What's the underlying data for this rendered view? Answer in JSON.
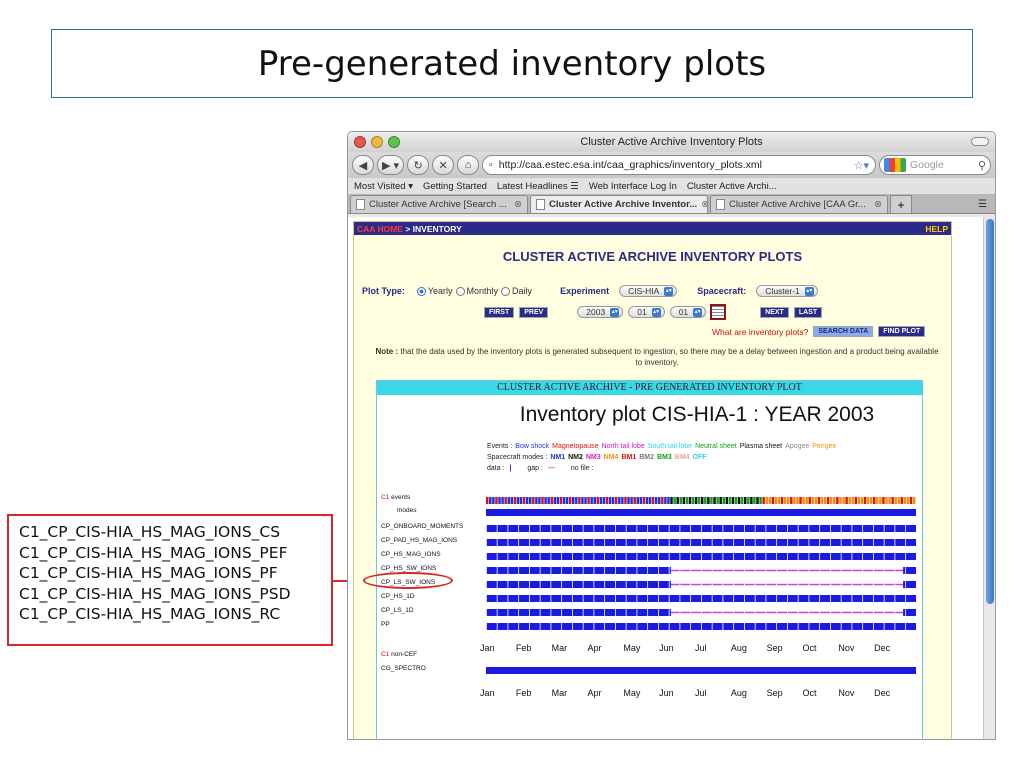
{
  "slide": {
    "title": "Pre-generated inventory plots",
    "callout_lines": [
      "C1_CP_CIS-HIA_HS_MAG_IONS_CS",
      "C1_CP_CIS-HIA_HS_MAG_IONS_PEF",
      "C1_CP_CIS-HIA_HS_MAG_IONS_PF",
      "C1_CP_CIS-HIA_HS_MAG_IONS_PSD",
      "C1_CP_CIS-HIA_HS_MAG_IONS_RC"
    ],
    "accent_color": "#d62a2a"
  },
  "browser": {
    "window_title": "Cluster Active Archive Inventory Plots",
    "url": "http://caa.estec.esa.int/caa_graphics/inventory_plots.xml",
    "search_placeholder": "Google",
    "bookmarks": [
      "Most Visited ▾",
      "Getting Started",
      "Latest Headlines ☰",
      "Web Interface Log In",
      "Cluster Active Archi..."
    ],
    "tabs": [
      {
        "label": "Cluster Active Archive [Search ..."
      },
      {
        "label": "Cluster Active Archive Inventor..."
      },
      {
        "label": "Cluster Active Archive [CAA Gr..."
      }
    ]
  },
  "page": {
    "home_link": "CAA HOME",
    "breadcrumb": "> INVENTORY",
    "help": "HELP",
    "heading": "CLUSTER ACTIVE ARCHIVE INVENTORY PLOTS",
    "plot_type_label": "Plot Type:",
    "plot_types": [
      "Yearly",
      "Monthly",
      "Daily"
    ],
    "experiment_label": "Experiment",
    "experiment_value": "CIS-HIA",
    "spacecraft_label": "Spacecraft:",
    "spacecraft_value": "Cluster-1",
    "first": "FIRST",
    "prev": "PREV",
    "year": "2003",
    "month": "01",
    "day": "01",
    "next": "NEXT",
    "last": "LAST",
    "what_link": "What are inventory plots?",
    "search_data": "SEARCH DATA",
    "find_plot": "FIND PLOT",
    "note_bold": "Note :",
    "note_text": "that the data used by the inventory plots is generated subsequent to ingestion, so there may be a delay between ingestion and a product being available to inventory."
  },
  "plot": {
    "header": "CLUSTER ACTIVE ARCHIVE - PRE GENERATED INVENTORY PLOT",
    "title": "Inventory plot CIS-HIA-1 : YEAR 2003",
    "events_label": "Events :",
    "events": [
      {
        "name": "Bow shock",
        "color": "#2030e0"
      },
      {
        "name": "Magnetopause",
        "color": "#e01010"
      },
      {
        "name": "North tail lobe",
        "color": "#d020d0"
      },
      {
        "name": "South tail lobe",
        "color": "#30d0f0"
      },
      {
        "name": "Neutral sheet",
        "color": "#10a010"
      },
      {
        "name": "Plasma sheet",
        "color": "#111111"
      },
      {
        "name": "Apogee",
        "color": "#888888"
      },
      {
        "name": "Perigee",
        "color": "#f09010"
      }
    ],
    "modes_label": "Spacecraft modes :",
    "modes": [
      {
        "name": "NM1",
        "color": "#2030e0"
      },
      {
        "name": "NM2",
        "color": "#111111"
      },
      {
        "name": "NM3",
        "color": "#d020d0"
      },
      {
        "name": "NM4",
        "color": "#f09010"
      },
      {
        "name": "BM1",
        "color": "#e01010"
      },
      {
        "name": "BM2",
        "color": "#777777"
      },
      {
        "name": "BM3",
        "color": "#10a010"
      },
      {
        "name": "BM4",
        "color": "#f0a0a0"
      },
      {
        "name": "OFF",
        "color": "#30d0f0"
      }
    ],
    "data_label": "data :",
    "gap_label": "gap :",
    "nofile_label": "no file :",
    "c1": "C1",
    "events_row": "events",
    "modes_row": "modes",
    "products": [
      "CP_ONBOARD_MOMENTS",
      "CP_PAD_HS_MAG_IONS",
      "CP_HS_MAG_IONS",
      "CP_HS_SW_IONS",
      "CP_LS_SW_IONS",
      "CP_HS_1D",
      "CP_LS_1D",
      "PP"
    ],
    "noncef_label": "non-CEF",
    "noncef_products": [
      "CG_SPECTRO"
    ],
    "months": [
      "Jan",
      "Feb",
      "Mar",
      "Apr",
      "May",
      "Jun",
      "Jul",
      "Aug",
      "Sep",
      "Oct",
      "Nov",
      "Dec"
    ],
    "data_color": "#1a1ae0",
    "gap_color": "#d040d0"
  }
}
